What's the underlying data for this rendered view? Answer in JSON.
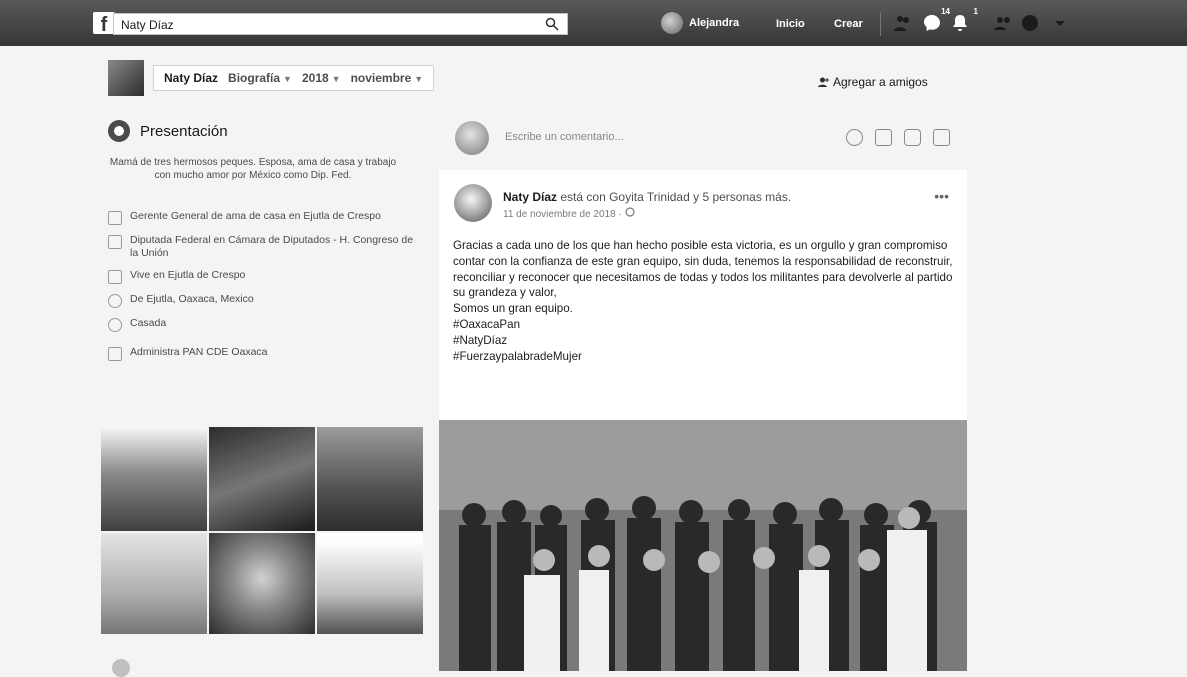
{
  "topbar": {
    "logo": "f",
    "search_value": "Naty Díaz",
    "user_name": "Alejandra",
    "nav_home": "Inicio",
    "nav_create": "Crear",
    "friend_badge": "14",
    "notif_badge": "1"
  },
  "subbar": {
    "name": "Naty Díaz",
    "section": "Biografía",
    "year": "2018",
    "month": "noviembre",
    "add_friends": "Agregar a amigos"
  },
  "intro": {
    "title": "Presentación",
    "bio": "Mamá de tres hermosos peques. Esposa, ama de casa y trabajo con mucho amor por México como Dip. Fed.",
    "items": [
      {
        "icon": "briefcase-icon",
        "text": "Gerente General de ama de casa en Ejutla de Crespo"
      },
      {
        "icon": "briefcase-icon",
        "text": "Diputada Federal en Cámara de Diputados - H. Congreso de la Unión"
      },
      {
        "icon": "home-icon",
        "text": "Vive en Ejutla de Crespo"
      },
      {
        "icon": "location-icon",
        "text": "De Ejutla, Oaxaca, Mexico"
      },
      {
        "icon": "heart-icon",
        "text": "Casada"
      },
      {
        "icon": "flag-icon",
        "text": "Administra PAN CDE Oaxaca"
      }
    ]
  },
  "composer": {
    "placeholder": "Escribe un comentario..."
  },
  "post": {
    "author": "Naty Díaz",
    "with_text": "está con Goyita Trinidad y 5 personas más.",
    "date": "11 de noviembre de 2018 ·",
    "more": "•••",
    "body": [
      "Gracias a cada uno de los que han hecho posible esta victoria, es un orgullo y gran compromiso contar con la confianza de este gran equipo, sin duda, tenemos la responsabilidad de reconstruir, reconciliar y reconocer que necesitamos de todas y todos los militantes para devolverle al partido su grandeza y valor,",
      "Somos un gran equipo.",
      "#OaxacaPan",
      "#NatyDíaz",
      "#FuerzaypalabradeMujer"
    ]
  }
}
